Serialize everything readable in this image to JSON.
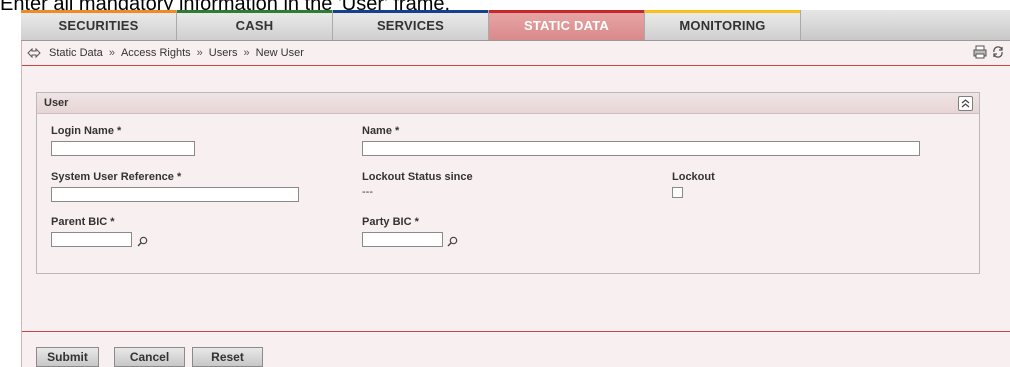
{
  "instruction": "Enter all mandatory information in the 'User' frame.",
  "nav": {
    "tabs": [
      {
        "label": "SECURITIES",
        "stripe": "#f08a24"
      },
      {
        "label": "CASH",
        "stripe": "#2e7d32"
      },
      {
        "label": "SERVICES",
        "stripe": "#1a3f8f"
      },
      {
        "label": "STATIC DATA",
        "stripe": "#c62828",
        "active": true
      },
      {
        "label": "MONITORING",
        "stripe": "#f6c21a"
      }
    ]
  },
  "breadcrumb": {
    "items": [
      "Static Data",
      "Access Rights",
      "Users",
      "New User"
    ],
    "separator": "»"
  },
  "icons": {
    "back": "back-arrows-icon",
    "print": "print-icon",
    "refresh": "refresh-icon",
    "collapse": "collapse-up-icon",
    "lookup": "magnifier-icon"
  },
  "panel": {
    "title": "User",
    "fields": {
      "login_name": {
        "label": "Login Name *",
        "value": ""
      },
      "name": {
        "label": "Name *",
        "value": ""
      },
      "system_user_reference": {
        "label": "System User Reference *",
        "value": ""
      },
      "lockout_status_since": {
        "label": "Lockout Status since",
        "value": "---"
      },
      "lockout": {
        "label": "Lockout",
        "checked": false
      },
      "parent_bic": {
        "label": "Parent BIC  *",
        "value": ""
      },
      "party_bic": {
        "label": "Party BIC  *",
        "value": ""
      }
    }
  },
  "actions": {
    "submit": "Submit",
    "cancel": "Cancel",
    "reset": "Reset"
  },
  "colors": {
    "accent_red": "#cc4444",
    "frame_background": "#f8f0f0",
    "active_tab": "#d98a8a"
  }
}
